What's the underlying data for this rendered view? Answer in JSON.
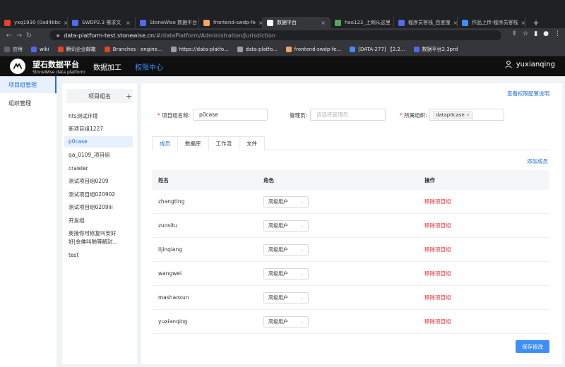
{
  "browser": {
    "tabs": [
      {
        "label": "yxq1930 (0ad4bbc",
        "color": "#e24329"
      },
      {
        "label": "SWDP2.3 需求文",
        "color": "#4f6bed"
      },
      {
        "label": "StoneWise 数据平台",
        "color": "#4f6bed"
      },
      {
        "label": "frontend-swdp-fe",
        "color": "#f4a460"
      },
      {
        "label": "数据平台",
        "color": "#ffffff",
        "active": true
      },
      {
        "label": "hao123_上网从这里",
        "color": "#58a55c"
      },
      {
        "label": "程序员客栈_百度搜",
        "color": "#4f6bed"
      },
      {
        "label": "作品上传-程序员客栈",
        "color": "#3e8ef7"
      }
    ],
    "address": {
      "host": "data-platform-test.stonewise.cn",
      "path": "/#/dataPlatform/Administration/Jurisdiction"
    },
    "bookmarks": [
      {
        "label": "应用",
        "color": "#5f6368"
      },
      {
        "label": "wiki",
        "color": "#4f6bed"
      },
      {
        "label": "腾讯企业邮箱",
        "color": "#e24329"
      },
      {
        "label": "Branches · engine...",
        "color": "#e24329"
      },
      {
        "label": "https://data-platfo...",
        "color": "#9aa0a6"
      },
      {
        "label": "data-platfo...",
        "color": "#9aa0a6"
      },
      {
        "label": "frontend-swdp-fe...",
        "color": "#f4a460"
      },
      {
        "label": "[DATA-277] 【2.2...",
        "color": "#3e8ef7"
      },
      {
        "label": "数据平台2.3prd",
        "color": "#4f6bed"
      }
    ]
  },
  "header": {
    "brand_cn": "望石数据平台",
    "brand_en": "StoneWise data platform",
    "nav": [
      {
        "label": "数据加工",
        "active": false
      },
      {
        "label": "权限中心",
        "active": true
      }
    ],
    "user": "yuxianqing"
  },
  "sidebar": {
    "items": [
      {
        "label": "项目组管理",
        "active": true
      },
      {
        "label": "组织管理",
        "active": false
      }
    ]
  },
  "groups": {
    "title": "项目组名",
    "add": "+",
    "items": [
      {
        "label": "hts测试环境"
      },
      {
        "label": "新项目组1227"
      },
      {
        "label": "p0case",
        "active": true
      },
      {
        "label": "qa_0109_项目组"
      },
      {
        "label": "crawler"
      },
      {
        "label": "测试项目组0209"
      },
      {
        "label": "测试项目组020902"
      },
      {
        "label": "测试项目组0209iii"
      },
      {
        "label": "开发组"
      },
      {
        "label": "奥接你可修复叫安好",
        "line2": "好|金佛叫啪等解封..."
      },
      {
        "label": "test"
      }
    ]
  },
  "main": {
    "help_link": "查看权限配置说明",
    "form": {
      "name_label": "项目组名称:",
      "name_value": "p0case",
      "manager_label": "管理员:",
      "manager_placeholder": "请选择管理员",
      "org_label": "所属组织:",
      "org_tag": "datap0case",
      "org_tag_close": "×"
    },
    "tabs": [
      {
        "label": "成员",
        "active": true
      },
      {
        "label": "数据库"
      },
      {
        "label": "工作流"
      },
      {
        "label": "文件"
      }
    ],
    "add_member": "添加成员",
    "table": {
      "headers": [
        "姓名",
        "角色",
        "操作"
      ],
      "rows": [
        {
          "name": "zhangting",
          "role": "高级用户",
          "action": "移除项目组"
        },
        {
          "name": "zuositu",
          "role": "高级用户",
          "action": "移除项目组"
        },
        {
          "name": "lijinqiang",
          "role": "高级用户",
          "action": "移除项目组"
        },
        {
          "name": "wangwei",
          "role": "高级用户",
          "action": "移除项目组"
        },
        {
          "name": "mashaoxun",
          "role": "高级用户",
          "action": "移除项目组"
        },
        {
          "name": "yuxianqing",
          "role": "高级用户",
          "action": "移除项目组"
        }
      ]
    },
    "save": "保存修改"
  },
  "colors": {
    "accent": "#3e8ef7",
    "link": "#1f6fd6",
    "danger": "#f5222d",
    "header_bg": "#0f0f10"
  }
}
